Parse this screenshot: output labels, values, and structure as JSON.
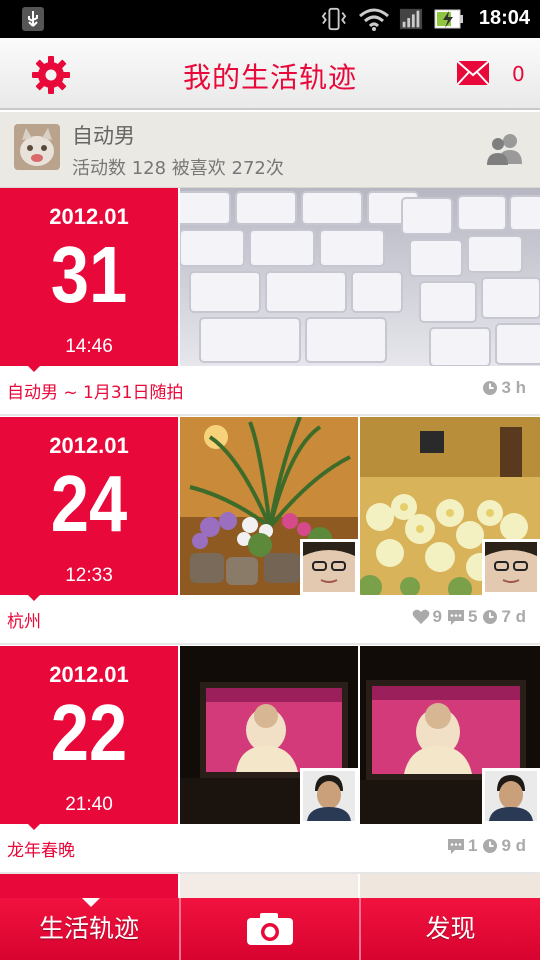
{
  "status_bar": {
    "time": "18:04"
  },
  "header": {
    "title": "我的生活轨迹",
    "mail_count": "0"
  },
  "profile": {
    "name": "自动男",
    "stats": "活动数 128  被喜欢 272次"
  },
  "entries": [
    {
      "year_month": "2012.01",
      "day": "31",
      "time": "14:46",
      "caption": "自动男 ~ 1月31日随拍",
      "ago": "3 h"
    },
    {
      "year_month": "2012.01",
      "day": "24",
      "time": "12:33",
      "caption": "杭州",
      "likes": "9",
      "comments": "5",
      "ago": "7 d"
    },
    {
      "year_month": "2012.01",
      "day": "22",
      "time": "21:40",
      "caption": "龙年春晚",
      "comments": "1",
      "ago": "9 d"
    }
  ],
  "tabbar": {
    "timeline": "生活轨迹",
    "discover": "发现"
  },
  "colors": {
    "accent": "#e8083a",
    "meta_gray": "#aaaaaa"
  }
}
